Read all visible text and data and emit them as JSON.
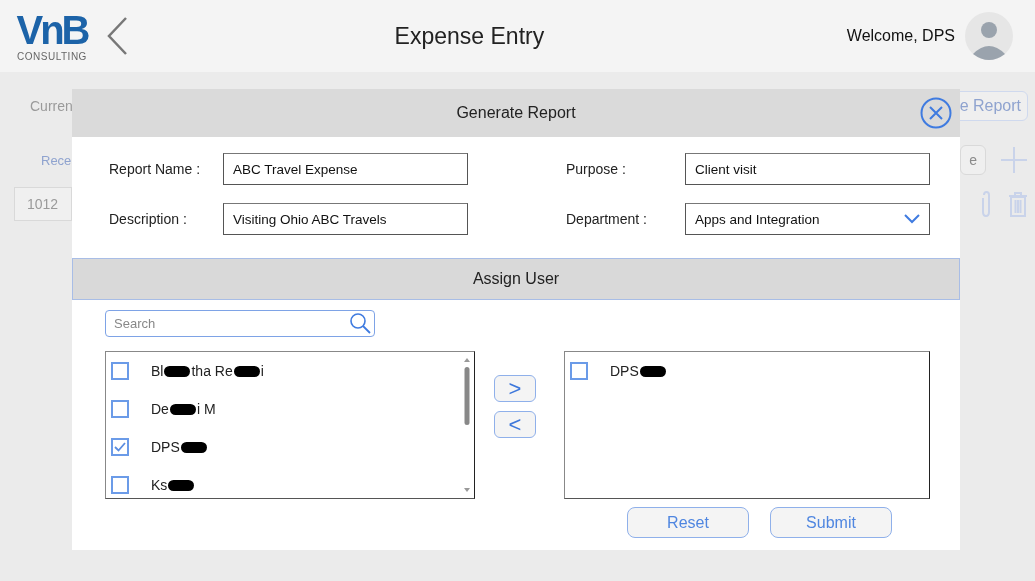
{
  "header": {
    "logo": {
      "mark": "VnB",
      "subtitle": "CONSULTING"
    },
    "title": "Expense Entry",
    "welcome": "Welcome, DPS"
  },
  "background": {
    "current_label": "Curren",
    "report_button": "e Report",
    "receipt_label": "Rece",
    "field_fragment": "e",
    "row_id": "1012"
  },
  "dialog": {
    "title": "Generate Report",
    "fields": [
      {
        "label": "Report Name :",
        "value": "ABC Travel Expense",
        "kind": "text"
      },
      {
        "label": "Purpose :",
        "value": "Client visit",
        "kind": "text"
      },
      {
        "label": "Description :",
        "value": "Visiting Ohio ABC Travels",
        "kind": "text"
      },
      {
        "label": "Department :",
        "value": "Apps and Integration",
        "kind": "dropdown"
      }
    ],
    "section_title": "Assign User",
    "search": {
      "placeholder": "Search"
    },
    "available_users": [
      {
        "checked": false,
        "name": [
          {
            "kind": "text",
            "text": "Bl"
          },
          {
            "kind": "redaction"
          },
          {
            "kind": "text",
            "text": "tha Re"
          },
          {
            "kind": "redaction"
          },
          {
            "kind": "text",
            "text": "i"
          }
        ]
      },
      {
        "checked": false,
        "name": [
          {
            "kind": "text",
            "text": "De"
          },
          {
            "kind": "redaction"
          },
          {
            "kind": "text",
            "text": "i M"
          }
        ]
      },
      {
        "checked": true,
        "name": [
          {
            "kind": "text",
            "text": "DPS"
          },
          {
            "kind": "redaction"
          }
        ]
      },
      {
        "checked": false,
        "name": [
          {
            "kind": "text",
            "text": "Ks"
          },
          {
            "kind": "redaction"
          }
        ]
      }
    ],
    "move_buttons": [
      ">",
      "<"
    ],
    "assigned_users": [
      {
        "checked": false,
        "name": [
          {
            "kind": "text",
            "text": "DPS"
          },
          {
            "kind": "redaction"
          }
        ]
      }
    ],
    "buttons": [
      "Reset",
      "Submit"
    ]
  }
}
